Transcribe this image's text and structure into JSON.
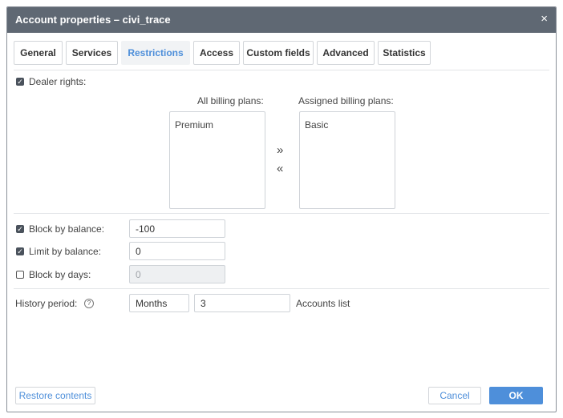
{
  "dialog": {
    "title": "Account properties – civi_trace",
    "close_glyph": "×"
  },
  "tabs": [
    {
      "label": "General"
    },
    {
      "label": "Services"
    },
    {
      "label": "Restrictions",
      "active": true
    },
    {
      "label": "Access"
    },
    {
      "label": "Custom fields"
    },
    {
      "label": "Advanced"
    },
    {
      "label": "Statistics"
    }
  ],
  "dealer_rights": {
    "label": "Dealer rights:",
    "checked": true
  },
  "billing": {
    "all_label": "All billing plans:",
    "assigned_label": "Assigned billing plans:",
    "all_plans": [
      "Premium"
    ],
    "assigned_plans": [
      "Basic"
    ],
    "add_glyph": "»",
    "remove_glyph": "«"
  },
  "restrictions": {
    "block_by_balance": {
      "label": "Block by balance:",
      "checked": true,
      "value": "-100"
    },
    "limit_by_balance": {
      "label": "Limit by balance:",
      "checked": true,
      "value": "0"
    },
    "block_by_days": {
      "label": "Block by days:",
      "checked": false,
      "value": "0"
    }
  },
  "history": {
    "label": "History period:",
    "help_glyph": "?",
    "unit": "Months",
    "value": "3",
    "accounts_link": "Accounts list"
  },
  "footer": {
    "restore_label": "Restore contents",
    "cancel_label": "Cancel",
    "ok_label": "OK"
  },
  "colors": {
    "titlebar": "#5f6873",
    "accent": "#4e8fda",
    "checkbox_checked": "#4a525c"
  },
  "icons": {
    "checkbox_check": "✓"
  }
}
